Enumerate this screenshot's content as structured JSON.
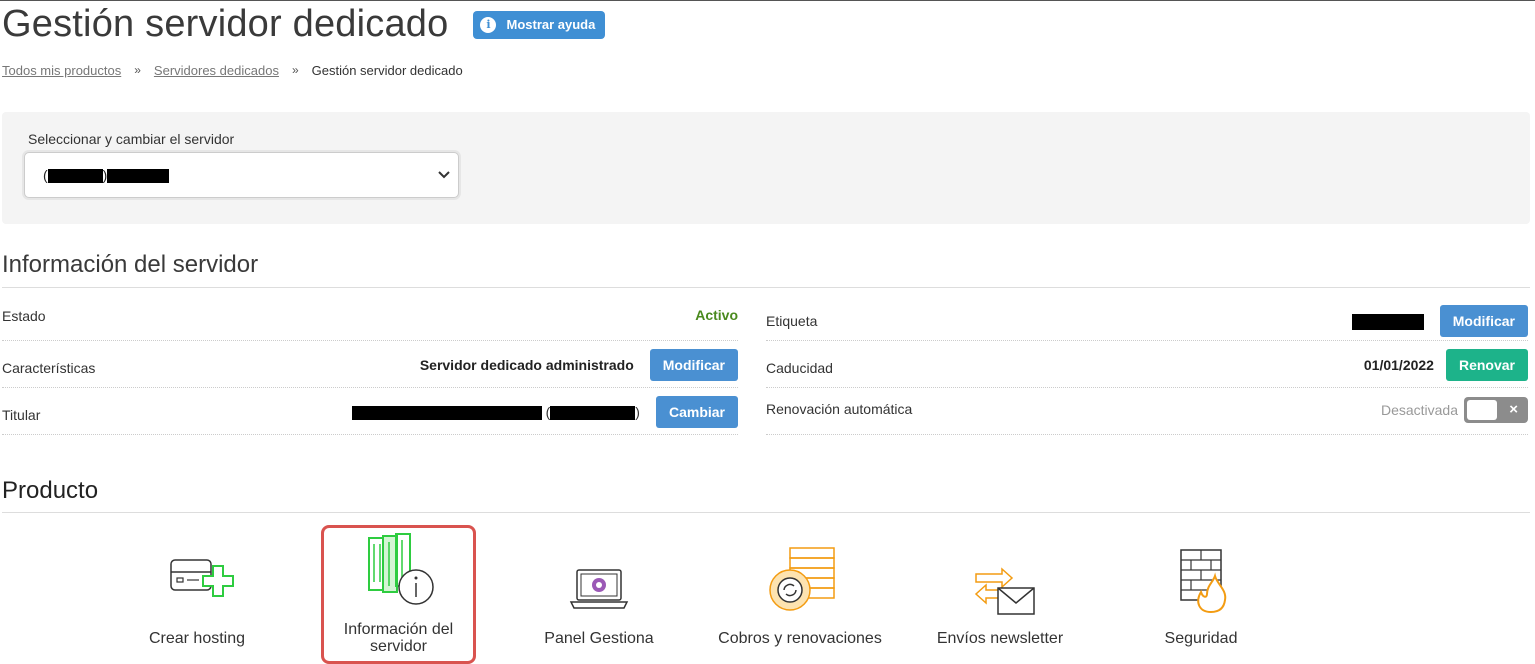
{
  "header": {
    "title": "Gestión servidor dedicado",
    "help_button": "Mostrar ayuda"
  },
  "breadcrumb": {
    "items": [
      "Todos mis productos",
      "Servidores dedicados",
      "Gestión servidor dedicado"
    ],
    "separator": "»"
  },
  "server_selector": {
    "label": "Seleccionar y cambiar el servidor",
    "selected_value": "(redacted)"
  },
  "server_info": {
    "title": "Información del servidor",
    "left_rows": [
      {
        "label": "Estado",
        "value": "Activo"
      },
      {
        "label": "Características",
        "value": "Servidor dedicado administrado",
        "button": "Modificar"
      },
      {
        "label": "Titular",
        "value": "(redacted)",
        "button": "Cambiar"
      }
    ],
    "right_rows": [
      {
        "label": "Etiqueta",
        "value": "(redacted)",
        "button": "Modificar"
      },
      {
        "label": "Caducidad",
        "value": "01/01/2022",
        "button": "Renovar"
      },
      {
        "label": "Renovación automática",
        "value": "Desactivada",
        "toggle_icon": "×"
      }
    ]
  },
  "product": {
    "title": "Producto",
    "items": [
      {
        "label": "Crear hosting",
        "icon": "server-plus-icon"
      },
      {
        "label": "Información del servidor",
        "icon": "server-info-icon",
        "selected": true
      },
      {
        "label": "Panel Gestiona",
        "icon": "laptop-panel-icon"
      },
      {
        "label": "Cobros y renovaciones",
        "icon": "coins-renew-icon"
      },
      {
        "label": "Envíos newsletter",
        "icon": "newsletter-icon"
      },
      {
        "label": "Seguridad",
        "icon": "firewall-icon"
      }
    ]
  },
  "colors": {
    "primary_blue": "#4a90d2",
    "renew_green": "#1db38a",
    "status_green": "#4a8a1e",
    "selected_border": "#d9534f"
  }
}
